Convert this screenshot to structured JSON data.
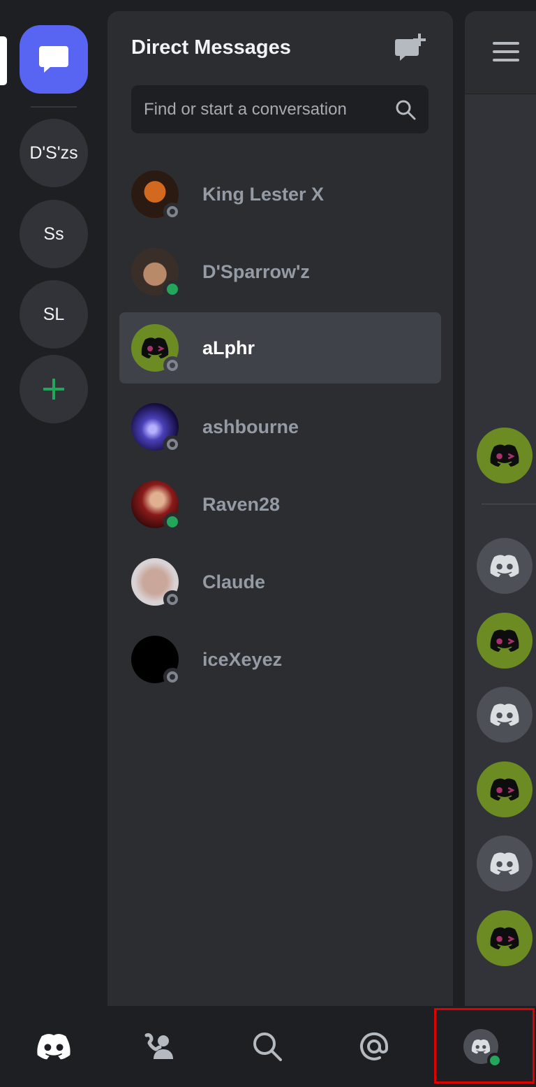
{
  "rail": {
    "dm_icon": "chat-bubble-icon",
    "servers": [
      {
        "label": "D'S'zs"
      },
      {
        "label": "Ss"
      },
      {
        "label": "SL"
      }
    ],
    "add_icon": "plus-icon"
  },
  "dm_panel": {
    "title": "Direct Messages",
    "new_dm_icon": "new-message-icon",
    "search": {
      "placeholder": "Find or start a conversation",
      "icon": "search-icon"
    },
    "conversations": [
      {
        "name": "King Lester X",
        "status": "offline"
      },
      {
        "name": "D'Sparrow'z",
        "status": "online"
      },
      {
        "name": "aLphr",
        "status": "offline",
        "selected": true
      },
      {
        "name": "ashbourne",
        "status": "offline"
      },
      {
        "name": "Raven28",
        "status": "online"
      },
      {
        "name": "Claude",
        "status": "offline"
      },
      {
        "name": "iceXeyez",
        "status": "offline"
      }
    ]
  },
  "bottom_nav": {
    "items": [
      "home-icon",
      "friends-icon",
      "search-icon",
      "mentions-icon",
      "profile-avatar"
    ]
  },
  "colors": {
    "brand": "#5865f2",
    "online": "#23a55a",
    "offline": "#80848e",
    "highlight": "#e00000",
    "avatar_green": "#6c8c23"
  }
}
